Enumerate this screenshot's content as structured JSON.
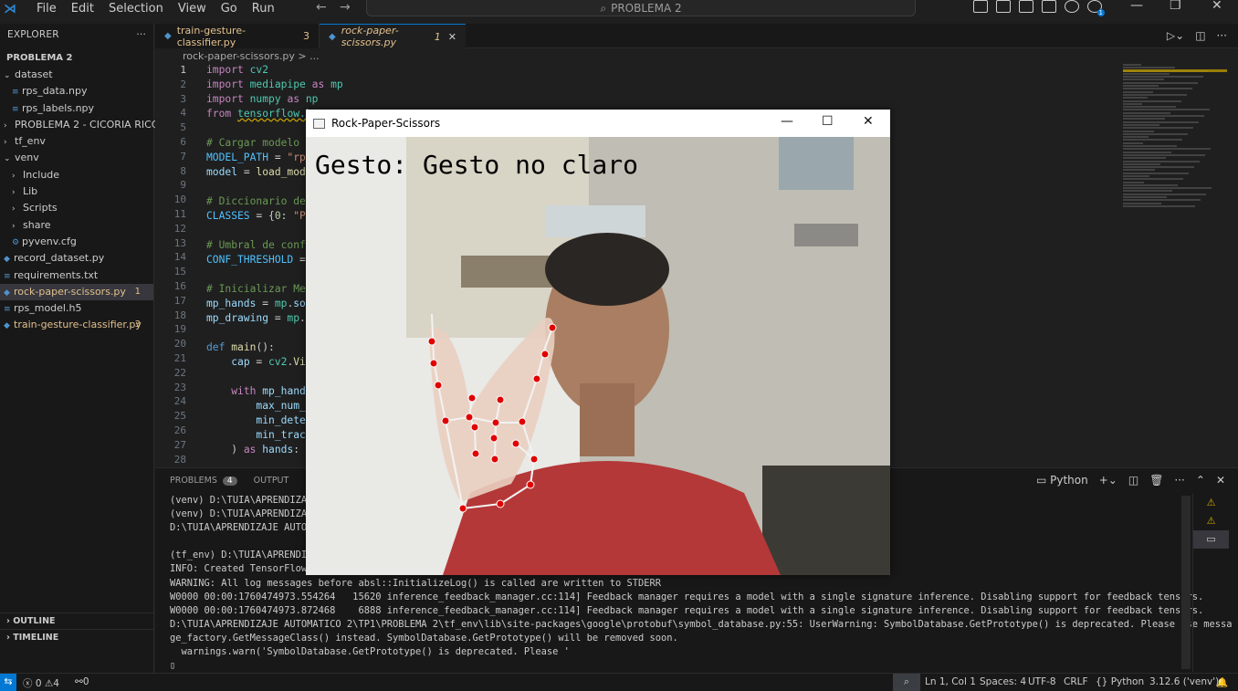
{
  "titlebar": {
    "menu": [
      "File",
      "Edit",
      "Selection",
      "View",
      "Go",
      "Run"
    ],
    "search_text": "PROBLEMA 2",
    "back_arrow": "←",
    "forward_arrow": "→",
    "notification_badge": "1"
  },
  "explorer": {
    "header": "EXPLORER",
    "more": "···",
    "root": "PROBLEMA 2",
    "items": [
      {
        "label": "dataset",
        "kind": "folder-open",
        "indent": 0
      },
      {
        "label": "rps_data.npy",
        "kind": "file",
        "indent": 1
      },
      {
        "label": "rps_labels.npy",
        "kind": "file",
        "indent": 1
      },
      {
        "label": "PROBLEMA 2 - CICORIA RICCI",
        "kind": "folder",
        "indent": 0
      },
      {
        "label": "tf_env",
        "kind": "folder",
        "indent": 0
      },
      {
        "label": "venv",
        "kind": "folder-open",
        "indent": 0
      },
      {
        "label": "Include",
        "kind": "folder",
        "indent": 1
      },
      {
        "label": "Lib",
        "kind": "folder",
        "indent": 1
      },
      {
        "label": "Scripts",
        "kind": "folder",
        "indent": 1
      },
      {
        "label": "share",
        "kind": "folder",
        "indent": 1
      },
      {
        "label": "pyvenv.cfg",
        "kind": "gear-file",
        "indent": 1
      },
      {
        "label": "record_dataset.py",
        "kind": "py",
        "indent": 0
      },
      {
        "label": "requirements.txt",
        "kind": "txt",
        "indent": 0
      },
      {
        "label": "rock-paper-scissors.py",
        "kind": "py",
        "indent": 0,
        "count": "1",
        "active": true,
        "modified": true
      },
      {
        "label": "rps_model.h5",
        "kind": "file",
        "indent": 0
      },
      {
        "label": "train-gesture-classifier.py",
        "kind": "py",
        "indent": 0,
        "count": "3",
        "modified": true
      }
    ],
    "outline": "OUTLINE",
    "timeline": "TIMELINE"
  },
  "tabs": [
    {
      "label": "train-gesture-classifier.py",
      "count": "3",
      "active": false
    },
    {
      "label": "rock-paper-scissors.py",
      "count": "1",
      "active": true,
      "close": "✕"
    }
  ],
  "breadcrumb": "rock-paper-scissors.py  >  ...",
  "editor": {
    "line_numbers": [
      "1",
      "2",
      "3",
      "4",
      "5",
      "6",
      "7",
      "8",
      "9",
      "10",
      "11",
      "12",
      "13",
      "14",
      "15",
      "16",
      "17",
      "18",
      "19",
      "20",
      "21",
      "22",
      "23",
      "24",
      "25",
      "26",
      "27",
      "28"
    ]
  },
  "panel": {
    "tabs": [
      "PROBLEMS",
      "OUTPUT",
      "DE"
    ],
    "problems_count": "4",
    "shell": "Python",
    "terminal_lines": [
      "(venv) D:\\TUIA\\APRENDIZAJ",
      "(venv) D:\\TUIA\\APRENDIZAJ",
      "D:\\TUIA\\APRENDIZAJE AUTOM",
      "",
      "(tf_env) D:\\TUIA\\APRENDIZ",
      "INFO: Created TensorFlow",
      "WARNING: All log messages before absl::InitializeLog() is called are written to STDERR",
      "W0000 00:00:1760474973.554264   15620 inference_feedback_manager.cc:114] Feedback manager requires a model with a single signature inference. Disabling support for feedback tensors.",
      "W0000 00:00:1760474973.872468    6888 inference_feedback_manager.cc:114] Feedback manager requires a model with a single signature inference. Disabling support for feedback tensors.",
      "D:\\TUIA\\APRENDIZAJE AUTOMATICO 2\\TP1\\PROBLEMA 2\\tf_env\\lib\\site-packages\\google\\protobuf\\symbol_database.py:55: UserWarning: SymbolDatabase.GetPrototype() is deprecated. Please use messa",
      "ge_factory.GetMessageClass() instead. SymbolDatabase.GetPrototype() will be removed soon.",
      "  warnings.warn('SymbolDatabase.GetPrototype() is deprecated. Please '",
      "▯"
    ]
  },
  "statusbar": {
    "errors": "0",
    "warnings": "4",
    "ports": "0",
    "position": "Ln 1, Col 1",
    "spaces": "Spaces: 4",
    "encoding": "UTF-8",
    "eol": "CRLF",
    "language": "Python",
    "interpreter": "3.12.6 ('venv')"
  },
  "cv_window": {
    "title": "Rock-Paper-Scissors",
    "overlay_text": "Gesto: Gesto no claro"
  },
  "colors": {
    "accent": "#0078d4",
    "modified": "#e2c08d",
    "landmark": "#e00000"
  }
}
